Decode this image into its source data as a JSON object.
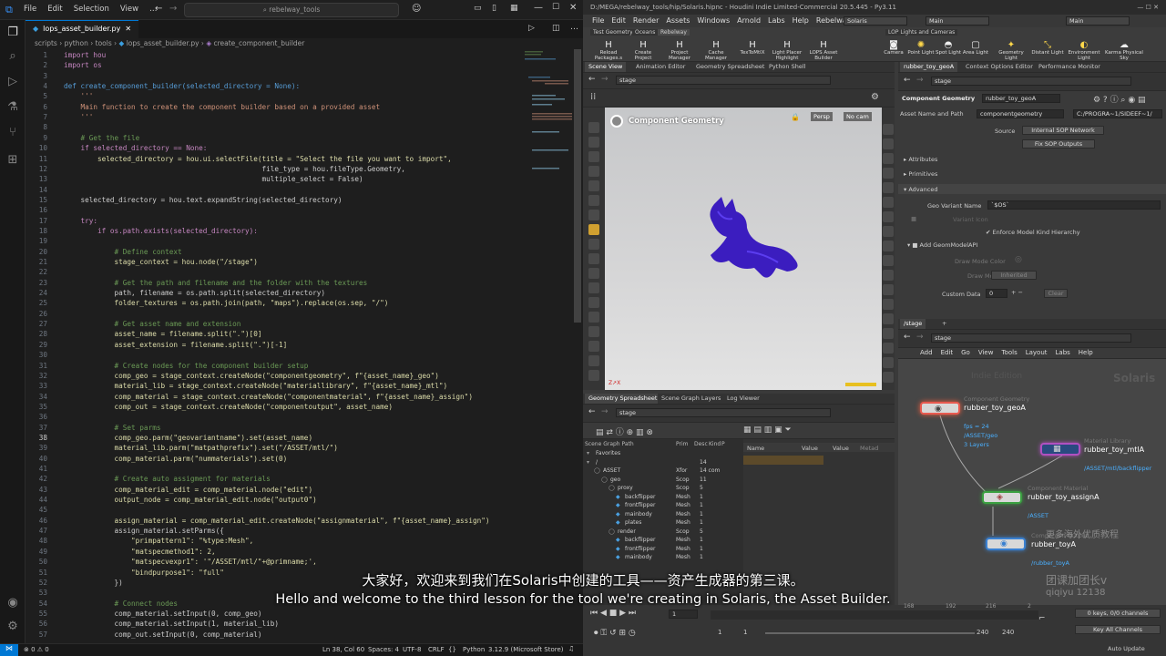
{
  "vscode": {
    "menu": [
      "File",
      "Edit",
      "Selection",
      "View",
      "…"
    ],
    "search": "rebelway_tools",
    "tab": "lops_asset_builder.py",
    "breadcrumb": [
      "scripts",
      "python",
      "tools",
      "lops_asset_builder.py",
      "create_component_builder"
    ],
    "status": {
      "errors": "⊗ 0 ⚠ 0",
      "cursor": "Ln 38, Col 60",
      "spaces": "Spaces: 4",
      "encoding": "UTF-8",
      "eol": "CRLF",
      "language": "Python",
      "version": "3.12.9 (Microsoft Store)"
    },
    "code": [
      {
        "n": "1",
        "t": "import hou",
        "c": "kw"
      },
      {
        "n": "2",
        "t": "import os",
        "c": "kw"
      },
      {
        "n": "3",
        "t": ""
      },
      {
        "n": "4",
        "t": "def create_component_builder(selected_directory = None):",
        "c": "def"
      },
      {
        "n": "5",
        "t": "    '''",
        "c": "str"
      },
      {
        "n": "6",
        "t": "    Main function to create the component builder based on a provided asset",
        "c": "str"
      },
      {
        "n": "7",
        "t": "    '''",
        "c": "str"
      },
      {
        "n": "8",
        "t": ""
      },
      {
        "n": "9",
        "t": "    # Get the file",
        "c": "cm"
      },
      {
        "n": "10",
        "t": "    if selected_directory == None:",
        "c": "kw"
      },
      {
        "n": "11",
        "t": "        selected_directory = hou.ui.selectFile(title = \"Select the file you want to import\","
      },
      {
        "n": "12",
        "t": "                                               file_type = hou.fileType.Geometry,"
      },
      {
        "n": "13",
        "t": "                                               multiple_select = False)"
      },
      {
        "n": "14",
        "t": ""
      },
      {
        "n": "15",
        "t": "    selected_directory = hou.text.expandString(selected_directory)"
      },
      {
        "n": "16",
        "t": ""
      },
      {
        "n": "17",
        "t": "    try:",
        "c": "kw"
      },
      {
        "n": "18",
        "t": "        if os.path.exists(selected_directory):",
        "c": "kw"
      },
      {
        "n": "19",
        "t": ""
      },
      {
        "n": "20",
        "t": "            # Define context",
        "c": "cm"
      },
      {
        "n": "21",
        "t": "            stage_context = hou.node(\"/stage\")"
      },
      {
        "n": "22",
        "t": ""
      },
      {
        "n": "23",
        "t": "            # Get the path and filename and the folder with the textures",
        "c": "cm"
      },
      {
        "n": "24",
        "t": "            path, filename = os.path.split(selected_directory)"
      },
      {
        "n": "25",
        "t": "            folder_textures = os.path.join(path, \"maps\").replace(os.sep, \"/\")"
      },
      {
        "n": "26",
        "t": ""
      },
      {
        "n": "27",
        "t": "            # Get asset name and extension",
        "c": "cm"
      },
      {
        "n": "28",
        "t": "            asset_name = filename.split(\".\")[0]"
      },
      {
        "n": "29",
        "t": "            asset_extension = filename.split(\".\")[-1]"
      },
      {
        "n": "30",
        "t": ""
      },
      {
        "n": "31",
        "t": "            # Create nodes for the component builder setup",
        "c": "cm"
      },
      {
        "n": "32",
        "t": "            comp_geo = stage_context.createNode(\"componentgeometry\", f\"{asset_name}_geo\")"
      },
      {
        "n": "33",
        "t": "            material_lib = stage_context.createNode(\"materiallibrary\", f\"{asset_name}_mtl\")"
      },
      {
        "n": "34",
        "t": "            comp_material = stage_context.createNode(\"componentmaterial\", f\"{asset_name}_assign\")"
      },
      {
        "n": "35",
        "t": "            comp_out = stage_context.createNode(\"componentoutput\", asset_name)"
      },
      {
        "n": "36",
        "t": ""
      },
      {
        "n": "37",
        "t": "            # Set parms",
        "c": "cm"
      },
      {
        "n": "38",
        "t": "            comp_geo.parm(\"geovariantname\").set(asset_name)"
      },
      {
        "n": "39",
        "t": "            material_lib.parm(\"matpathprefix\").set(\"/ASSET/mtl/\")"
      },
      {
        "n": "40",
        "t": "            comp_material.parm(\"nummaterials\").set(0)"
      },
      {
        "n": "41",
        "t": ""
      },
      {
        "n": "42",
        "t": "            # Create auto assigment for materials",
        "c": "cm"
      },
      {
        "n": "43",
        "t": "            comp_material_edit = comp_material.node(\"edit\")"
      },
      {
        "n": "44",
        "t": "            output_node = comp_material_edit.node(\"output0\")"
      },
      {
        "n": "45",
        "t": ""
      },
      {
        "n": "46",
        "t": "            assign_material = comp_material_edit.createNode(\"assignmaterial\", f\"{asset_name}_assign\")"
      },
      {
        "n": "47",
        "t": "            assign_material.setParms({"
      },
      {
        "n": "48",
        "t": "                \"primpattern1\": \"%type:Mesh\","
      },
      {
        "n": "49",
        "t": "                \"matspecmethod1\": 2,"
      },
      {
        "n": "50",
        "t": "                \"matspecvexpr1\": '\"/ASSET/mtl/\"+@primname;',"
      },
      {
        "n": "51",
        "t": "                \"bindpurpose1\": \"full\""
      },
      {
        "n": "52",
        "t": "            })"
      },
      {
        "n": "53",
        "t": ""
      },
      {
        "n": "54",
        "t": "            # Connect nodes",
        "c": "cm"
      },
      {
        "n": "55",
        "t": "            comp_material.setInput(0, comp_geo)"
      },
      {
        "n": "56",
        "t": "            comp_material.setInput(1, material_lib)"
      },
      {
        "n": "57",
        "t": "            comp_out.setInput(0, comp_material)"
      }
    ]
  },
  "houdini": {
    "title": "D:/MEGA/rebelway_tools/hip/Solaris.hipnc - Houdini Indie Limited-Commercial 20.5.445 - Py3.11",
    "menu": [
      "File",
      "Edit",
      "Render",
      "Assets",
      "Windows",
      "Arnold",
      "Labs",
      "Help",
      "Rebelway Tools"
    ],
    "desktop": "Solaris",
    "main1": "Main",
    "main2": "Main",
    "shelf_tabs": [
      "Test Geometry",
      "Oceans",
      "Rebelway"
    ],
    "shelf_tabs2": [
      "LOP Lights and Cameras"
    ],
    "tools": [
      "Reload Packages.s",
      "Create Project",
      "Project Manager",
      "Cache Manager",
      "TexToMtlX",
      "Light Placer Highlight",
      "LOPS Asset Builder"
    ],
    "tools2": [
      "Camera",
      "Point Light",
      "Spot Light",
      "Area Light",
      "Geometry Light",
      "Distant Light",
      "Environment Light",
      "Karma Physical Sky"
    ],
    "view_tabs": [
      "Scene View",
      "Animation Editor",
      "Geometry Spreadsheet",
      "Python Shell"
    ],
    "param_tabs": [
      "rubber_toy_geoA",
      "Context Options Editor",
      "Performance Monitor"
    ],
    "path": "stage",
    "viewport": {
      "label": "Component Geometry",
      "persp": "Persp",
      "cam": "No cam"
    },
    "params": {
      "type": "Component Geometry",
      "name": "rubber_toy_geoA",
      "asset_label": "Asset Name and Path",
      "asset_value": "componentgeometry",
      "asset_path": "C:/PROGRA~1/SIDEEF~1/",
      "source_label": "Source",
      "source_value": "Internal SOP Network",
      "fix_btn": "Fix SOP Outputs",
      "attributes": "Attributes",
      "primitives": "Primitives",
      "advanced": "Advanced",
      "geo_variant_label": "Geo Variant Name",
      "geo_variant_value": "`$OS`",
      "variant_icon": "Variant Icon",
      "enforce": "Enforce Model Kind Hierarchy",
      "add_geom": "Add GeomModelAPI",
      "draw_color": "Draw Mode Color",
      "draw_mode": "Draw Mode",
      "draw_mode_value": "Inherited",
      "custom_data": "Custom Data",
      "custom_value": "0",
      "clear": "Clear"
    },
    "net": {
      "tab": "/stage",
      "path": "stage",
      "menu": [
        "Add",
        "Edit",
        "Go",
        "View",
        "Tools",
        "Layout",
        "Labs",
        "Help"
      ],
      "watermark": "Indie Edition",
      "context": "Solaris",
      "nodes": [
        {
          "type": "Component Geometry",
          "name": "rubber_toy_geoA",
          "info": [
            "fps = 24",
            "/ASSET/geo",
            "3 Layers"
          ]
        },
        {
          "type": "Material Library",
          "name": "rubber_toy_mtlA",
          "info": [
            "/ASSET/mtl/backflipper"
          ]
        },
        {
          "type": "Component Material",
          "name": "rubber_toy_assignA",
          "info": [
            "/ASSET"
          ]
        },
        {
          "type": "Component Output",
          "name": "rubber_toyA",
          "info": [
            "/rubber_toyA"
          ]
        }
      ]
    },
    "sg_tabs": [
      "Geometry Spreadsheet",
      "Scene Graph Layers",
      "Log Viewer"
    ],
    "sg": {
      "headers": [
        "Scene Graph Path",
        "Prim",
        "Desc",
        "Kind",
        "P"
      ],
      "rows": [
        {
          "name": "Favorites",
          "prim": "",
          "desc": "",
          "d": 0
        },
        {
          "name": "/",
          "prim": "",
          "desc": "14",
          "d": 0
        },
        {
          "name": "ASSET",
          "prim": "Xfor",
          "desc": "14 com",
          "d": 1
        },
        {
          "name": "geo",
          "prim": "Scop",
          "desc": "11",
          "d": 2
        },
        {
          "name": "proxy",
          "prim": "Scop",
          "desc": "5",
          "d": 3
        },
        {
          "name": "backflipper",
          "prim": "Mesh",
          "desc": "1",
          "d": 4
        },
        {
          "name": "frontflipper",
          "prim": "Mesh",
          "desc": "1",
          "d": 4
        },
        {
          "name": "mainbody",
          "prim": "Mesh",
          "desc": "1",
          "d": 4
        },
        {
          "name": "plates",
          "prim": "Mesh",
          "desc": "1",
          "d": 4
        },
        {
          "name": "render",
          "prim": "Scop",
          "desc": "5",
          "d": 3
        },
        {
          "name": "backflipper",
          "prim": "Mesh",
          "desc": "1",
          "d": 4
        },
        {
          "name": "frontflipper",
          "prim": "Mesh",
          "desc": "1",
          "d": 4
        },
        {
          "name": "mainbody",
          "prim": "Mesh",
          "desc": "1",
          "d": 4
        }
      ],
      "prop_headers": [
        "Name",
        "Value",
        "Value",
        "Metad"
      ]
    },
    "timeline": {
      "frame": "1",
      "start": "1",
      "start2": "1",
      "end": "240",
      "end2": "240",
      "keys": "0 keys, 0/0 channels",
      "key_all": "Key All Channels",
      "auto_update": "Auto Update",
      "ticks": [
        "168",
        "192",
        "216",
        "2"
      ]
    }
  },
  "watermarks": [
    "更多海外优质教程",
    "团课加团长v",
    "qiqiyu 12138"
  ],
  "subtitle_cn": "大家好，欢迎来到我们在Solaris中创建的工具——资产生成器的第三课。",
  "subtitle_en": "Hello and welcome to the third lesson for the tool we're creating in Solaris, the Asset Builder."
}
